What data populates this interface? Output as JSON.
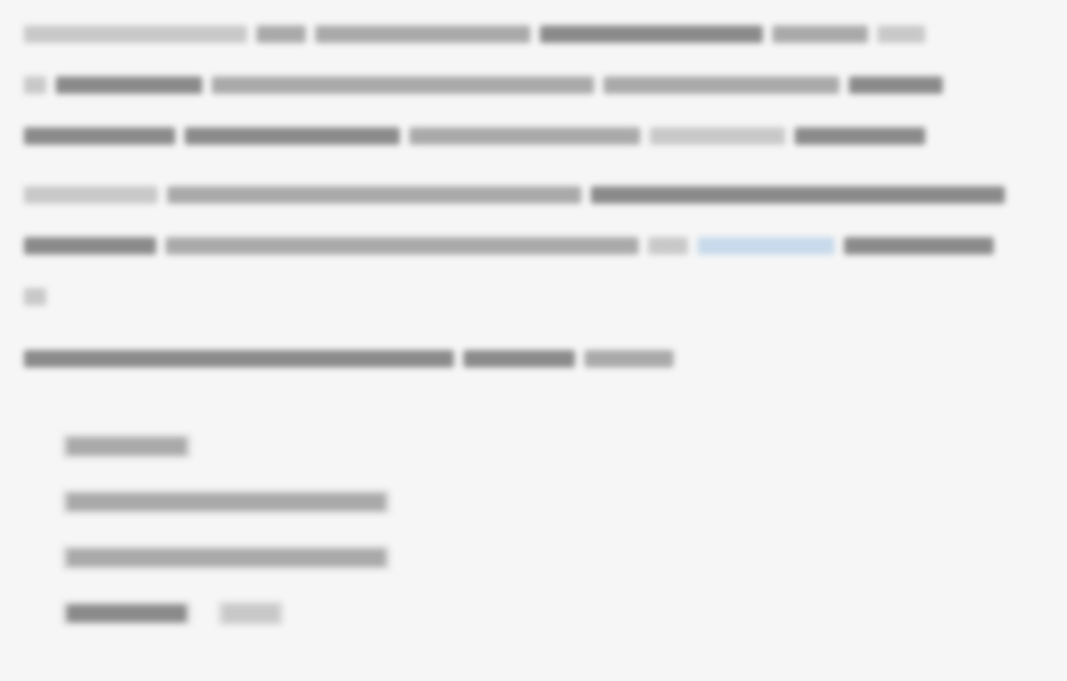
{
  "document": {
    "paragraphs": [
      {
        "id": "p1",
        "lines": [
          [
            {
              "tone": "light",
              "w": 280
            },
            {
              "tone": "mid",
              "w": 62
            },
            {
              "tone": "mid",
              "w": 270
            },
            {
              "tone": "dark",
              "w": 280
            },
            {
              "tone": "mid",
              "w": 120
            },
            {
              "tone": "light",
              "w": 60
            }
          ],
          [
            {
              "tone": "light",
              "w": 28
            },
            {
              "tone": "dark",
              "w": 184
            },
            {
              "tone": "mid",
              "w": 480
            },
            {
              "tone": "mid",
              "w": 296
            },
            {
              "tone": "dark",
              "w": 118
            }
          ],
          [
            {
              "tone": "dark",
              "w": 190
            },
            {
              "tone": "dark",
              "w": 270
            },
            {
              "tone": "mid",
              "w": 290
            },
            {
              "tone": "light",
              "w": 170
            },
            {
              "tone": "dark",
              "w": 164
            }
          ]
        ]
      },
      {
        "id": "p2",
        "lines": [
          [
            {
              "tone": "light",
              "w": 168
            },
            {
              "tone": "mid",
              "w": 520
            },
            {
              "tone": "dark",
              "w": 520
            }
          ],
          [
            {
              "tone": "dark",
              "w": 166
            },
            {
              "tone": "mid",
              "w": 594
            },
            {
              "tone": "light",
              "w": 50
            },
            {
              "tone": "link",
              "w": 172
            },
            {
              "tone": "dark",
              "w": 188
            }
          ],
          [
            {
              "tone": "light",
              "w": 28
            }
          ]
        ]
      },
      {
        "id": "p3",
        "lines": [
          [
            {
              "tone": "dark",
              "w": 540
            },
            {
              "tone": "dark",
              "w": 140
            },
            {
              "tone": "mid",
              "w": 112
            }
          ]
        ]
      }
    ],
    "list": [
      {
        "id": "item-1",
        "pill": true,
        "segments": [
          {
            "tone": "mid",
            "w": 150
          }
        ]
      },
      {
        "id": "item-2",
        "pill": true,
        "segments": [
          {
            "tone": "mid",
            "w": 400
          }
        ]
      },
      {
        "id": "item-3",
        "pill": true,
        "segments": [
          {
            "tone": "mid",
            "w": 400
          }
        ]
      },
      {
        "id": "item-4",
        "pill": true,
        "segments": [
          {
            "tone": "dark",
            "w": 150
          },
          {
            "tone": "light",
            "w": 70
          }
        ]
      }
    ]
  }
}
